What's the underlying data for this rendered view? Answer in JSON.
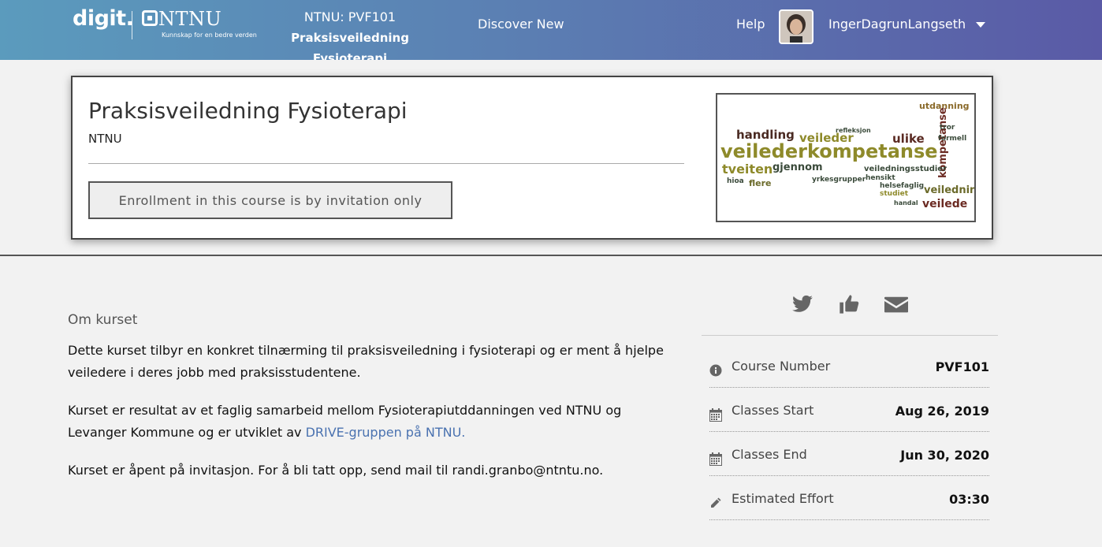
{
  "header": {
    "brand": "digit.",
    "ntnu_name": "NTNU",
    "ntnu_tagline": "Kunnskap for en bedre verden",
    "course_code_line": "NTNU: PVF101",
    "course_name_line": "Praksisveiledning Fysioterapi",
    "nav_discover": "Discover New",
    "nav_help": "Help",
    "username": "IngerDagrunLangseth"
  },
  "hero": {
    "title": "Praksisveiledning Fysioterapi",
    "org": "NTNU",
    "enrollment_message": "Enrollment in this course is by invitation only",
    "wordcloud_words": [
      "utdanning",
      "handling",
      "veilederkompetanse",
      "ulike",
      "veileder",
      "tveiten",
      "gjennom",
      "kompetanse",
      "veiledningsstudier",
      "veiledning",
      "veilede",
      "flere",
      "hioa",
      "yrkesgrupper",
      "hensikt",
      "helsefaglig",
      "tror",
      "formell",
      "studiet",
      "handal",
      "refleksjon"
    ]
  },
  "about": {
    "heading": "Om kurset",
    "p1": "Dette kurset tilbyr en konkret tilnærming til praksisveiledning i fysioterapi og er ment å hjelpe veiledere i deres jobb med praksisstudentene.",
    "p2_before": "Kurset er resultat av et faglig samarbeid mellom Fysioterapiutddanningen ved NTNU og Levanger Kommune og er utviklet av ",
    "p2_link": "DRIVE-gruppen på NTNU.",
    "p3": "Kurset er åpent på invitasjon. For å bli tatt opp, send mail til randi.granbo@ntntu.no."
  },
  "sidebar": {
    "share_icons": [
      "twitter-icon",
      "thumbs-up-icon",
      "envelope-icon"
    ],
    "facts": [
      {
        "icon": "info-icon",
        "label": "Course Number",
        "value": "PVF101"
      },
      {
        "icon": "calendar-icon",
        "label": "Classes Start",
        "value": "Aug 26, 2019"
      },
      {
        "icon": "calendar-icon",
        "label": "Classes End",
        "value": "Jun 30, 2020"
      },
      {
        "icon": "pencil-icon",
        "label": "Estimated Effort",
        "value": "03:30"
      }
    ]
  },
  "colors": {
    "header_gradient_start": "#5b9bbd",
    "header_gradient_end": "#5a5aa6",
    "link": "#4a72b0",
    "icon_gray": "#666666"
  }
}
